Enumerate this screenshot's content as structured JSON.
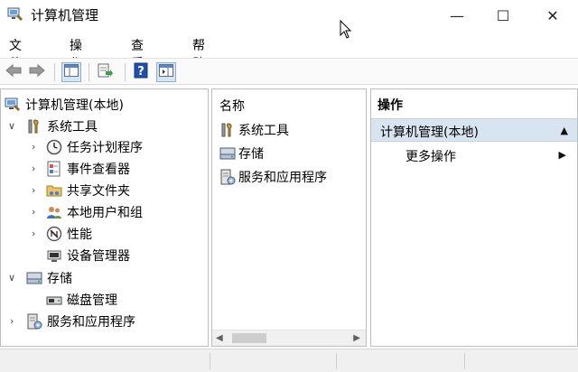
{
  "window": {
    "title": "计算机管理",
    "minimize_glyph": "—",
    "maximize_glyph": "☐",
    "close_glyph": "✕"
  },
  "menu": [
    "文件(F)",
    "操作(A)",
    "查看(V)",
    "帮助(H)"
  ],
  "toolbar": {
    "buttons": [
      "back-arrow-icon",
      "forward-arrow-icon",
      "show-hide-console-tree-icon",
      "export-list-icon",
      "help-icon",
      "show-hide-action-pane-icon"
    ]
  },
  "tree": {
    "root_label": "计算机管理(本地)",
    "system_tools": "系统工具",
    "task_scheduler": "任务计划程序",
    "event_viewer": "事件查看器",
    "shared_folders": "共享文件夹",
    "local_users": "本地用户和组",
    "performance": "性能",
    "device_manager": "设备管理器",
    "storage": "存储",
    "disk_management": "磁盘管理",
    "services_apps": "服务和应用程序"
  },
  "middle": {
    "header": "名称",
    "items": [
      "系统工具",
      "存储",
      "服务和应用程序"
    ]
  },
  "actions": {
    "header": "操作",
    "section_title": "计算机管理(本地)",
    "more": "更多操作"
  },
  "colors": {
    "selection": "#d9e4f1",
    "accent": "#1e5fb4"
  }
}
